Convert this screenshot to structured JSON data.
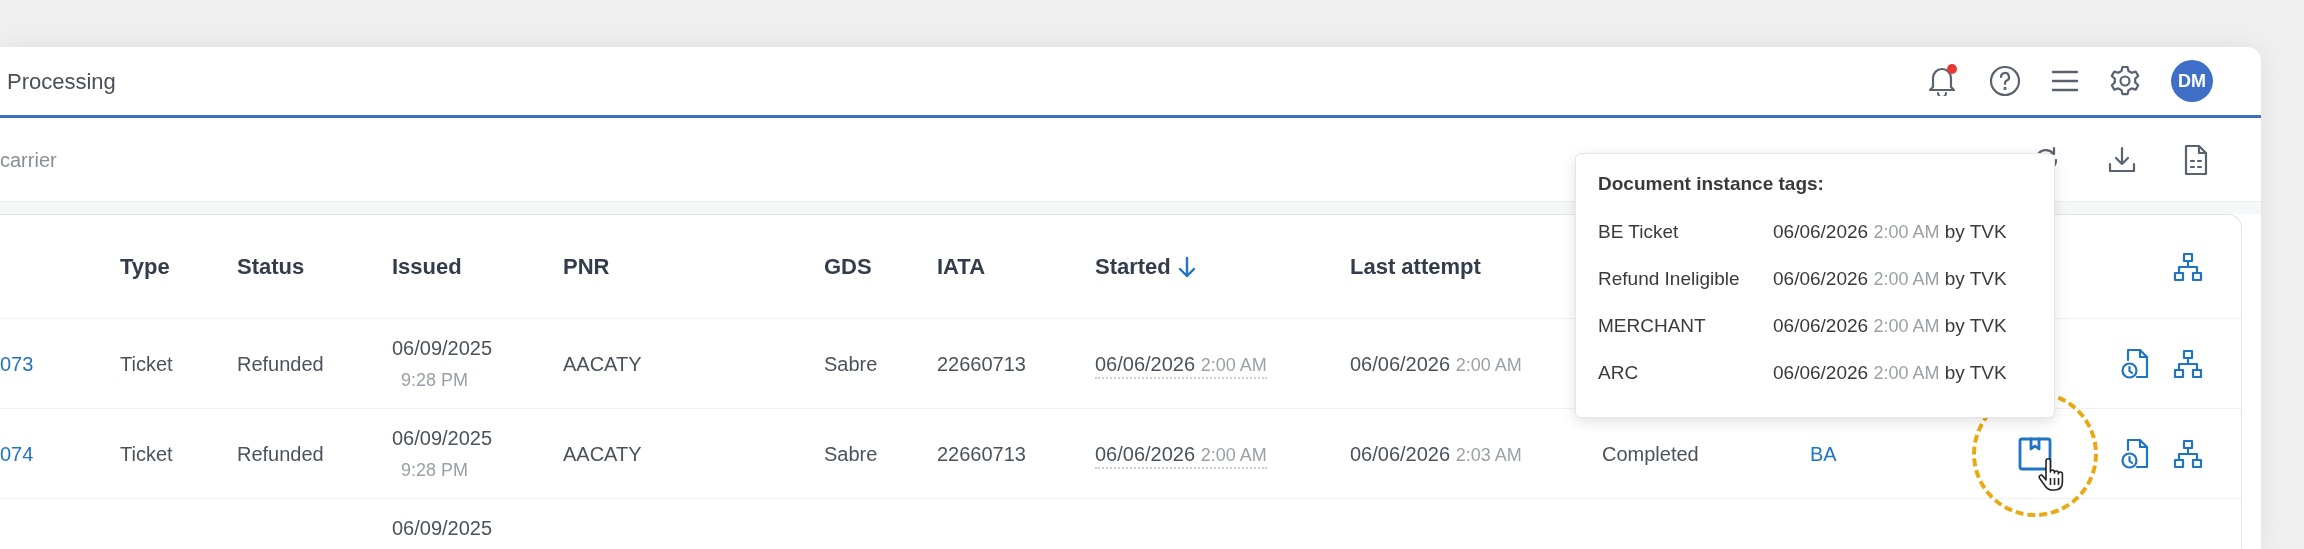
{
  "header": {
    "title": "Processing",
    "notification_dot": true,
    "avatar_initials": "DM"
  },
  "toolbar": {
    "search": {
      "placeholder": "carrier"
    }
  },
  "table": {
    "headers": [
      {
        "label": "Type",
        "sorted": false
      },
      {
        "label": "Status",
        "sorted": false
      },
      {
        "label": "Issued",
        "sorted": false
      },
      {
        "label": "PNR",
        "sorted": false
      },
      {
        "label": "GDS",
        "sorted": false
      },
      {
        "label": "IATA",
        "sorted": false
      },
      {
        "label": "Started",
        "sorted": true
      },
      {
        "label": "Last attempt",
        "sorted": false
      }
    ],
    "rows": [
      {
        "column_1": "073",
        "type": "Ticket",
        "status": "Refunded",
        "issued_date": "06/09/2025",
        "issued_time": "9:28 PM",
        "pnr": "AACATY",
        "gds": "Sabre",
        "iata": "22660713",
        "started_date": "06/06/2026",
        "started_time": "2:00 AM",
        "last_attempt_date": "06/06/2026",
        "last_attempt_time": "2:00 AM",
        "actions": [
          {
            "kind": "history",
            "highlighted": false
          },
          {
            "kind": "hierarchy",
            "highlighted": false
          }
        ]
      },
      {
        "column_1": "074",
        "type": "Ticket",
        "status": "Refunded",
        "issued_date": "06/09/2025",
        "issued_time": "9:28 PM",
        "pnr": "AACATY",
        "gds": "Sabre",
        "iata": "22660713",
        "started_date": "06/06/2026",
        "started_time": "2:00 AM",
        "last_attempt_date": "06/06/2026",
        "last_attempt_time": "2:03 AM",
        "column_10": "Completed",
        "column_11": "BA",
        "actions": [
          {
            "kind": "tags",
            "highlighted": true
          },
          {
            "kind": "history",
            "highlighted": false
          },
          {
            "kind": "hierarchy",
            "highlighted": false
          }
        ]
      },
      {
        "issued_date": "06/09/2025"
      }
    ]
  },
  "tooltip": {
    "title": "Document instance tags:",
    "tags": [
      {
        "name": "BE Ticket",
        "date": "06/06/2026",
        "time": "2:00 AM",
        "by": "by TVK"
      },
      {
        "name": "Refund Ineligible",
        "date": "06/06/2026",
        "time": "2:00 AM",
        "by": "by TVK"
      },
      {
        "name": "MERCHANT",
        "date": "06/06/2026",
        "time": "2:00 AM",
        "by": "by TVK"
      },
      {
        "name": "ARC",
        "date": "06/06/2026",
        "time": "2:00 AM",
        "by": "by TVK"
      }
    ]
  }
}
